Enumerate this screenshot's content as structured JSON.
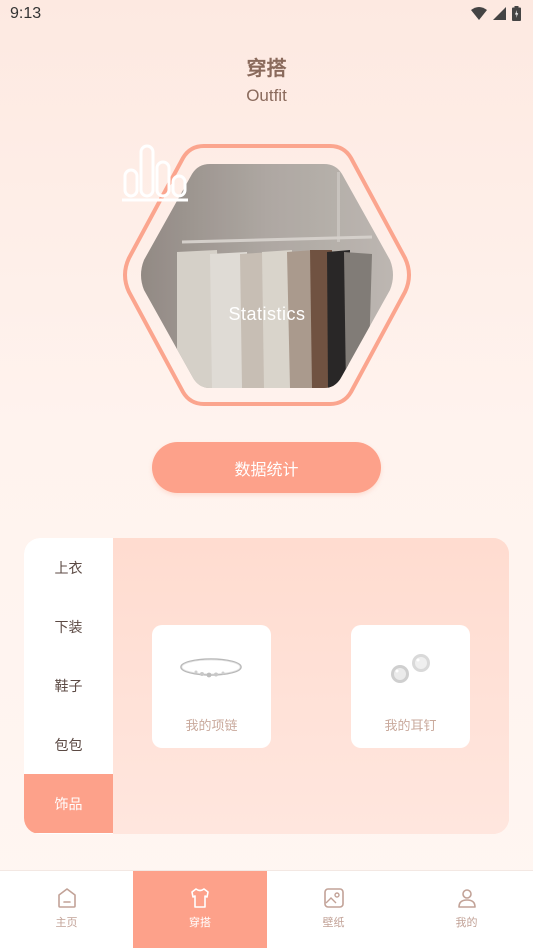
{
  "status_bar": {
    "time": "9:13"
  },
  "header": {
    "title": "穿搭",
    "subtitle": "Outfit"
  },
  "hero": {
    "label": "Statistics",
    "icon": "bar-chart-icon"
  },
  "stats_button": {
    "label": "数据统计"
  },
  "categories": {
    "items": [
      "上衣",
      "下装",
      "鞋子",
      "包包",
      "饰品"
    ],
    "selected": "饰品"
  },
  "cards": [
    {
      "label": "我的项链",
      "icon": "necklace-image"
    },
    {
      "label": "我的耳钉",
      "icon": "earrings-image"
    }
  ],
  "bottom_nav": {
    "items": [
      {
        "label": "主页",
        "icon": "home-icon"
      },
      {
        "label": "穿搭",
        "icon": "shirt-icon"
      },
      {
        "label": "壁纸",
        "icon": "wallpaper-icon"
      },
      {
        "label": "我的",
        "icon": "person-icon"
      }
    ],
    "selected": "穿搭"
  },
  "colors": {
    "accent": "#fda18a",
    "panel": "#ffe0d6",
    "text": "#8a6a5c"
  }
}
